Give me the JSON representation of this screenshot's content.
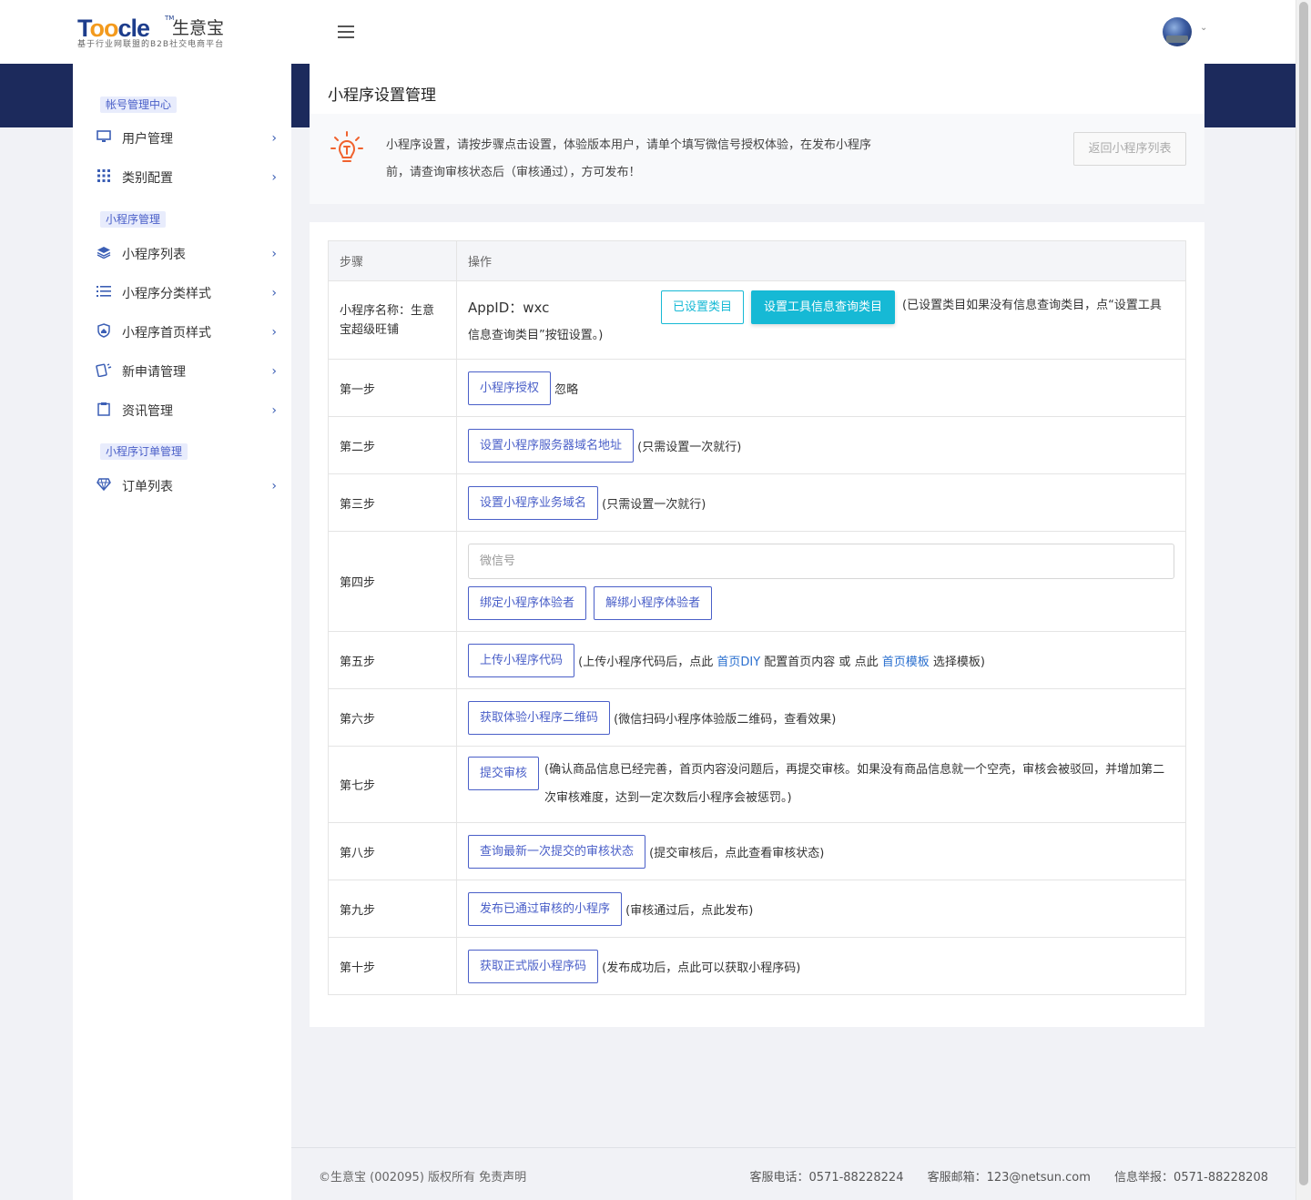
{
  "header": {
    "logo_brand_a": "T",
    "logo_brand_oo": "oo",
    "logo_brand_b": "cle",
    "logo_tm": "TM",
    "logo_cn": "生意宝",
    "logo_slogan": "基于行业网联盟的B2B社交电商平台"
  },
  "sidebar": {
    "sections": [
      {
        "title": "帐号管理中心",
        "items": [
          {
            "label": "用户管理",
            "icon": "monitor-icon"
          },
          {
            "label": "类别配置",
            "icon": "grid-icon"
          }
        ]
      },
      {
        "title": "小程序管理",
        "items": [
          {
            "label": "小程序列表",
            "icon": "layers-icon"
          },
          {
            "label": "小程序分类样式",
            "icon": "list-icon"
          },
          {
            "label": "小程序首页样式",
            "icon": "shield-home-icon"
          },
          {
            "label": "新申请管理",
            "icon": "cards-icon"
          },
          {
            "label": "资讯管理",
            "icon": "clipboard-icon"
          }
        ]
      },
      {
        "title": "小程序订单管理",
        "items": [
          {
            "label": "订单列表",
            "icon": "diamond-icon"
          }
        ]
      }
    ]
  },
  "page": {
    "title": "小程序设置管理",
    "tip_line1": "小程序设置，请按步骤点击设置，体验版本用户，请单个填写微信号授权体验，在发布小程序",
    "tip_line2": "前，请查询审核状态后（审核通过），方可发布！",
    "back_button": "返回小程序列表"
  },
  "table": {
    "headers": [
      "步骤",
      "操作"
    ],
    "info_row": {
      "name": "小程序名称：生意宝超级旺铺",
      "appid": "AppID：wxc",
      "btn_set_category": "已设置类目",
      "btn_set_tool_category": "设置工具信息查询类目",
      "note": "(已设置类目如果没有信息查询类目，点“设置工具信息查询类目”按钮设置。)"
    },
    "steps": [
      {
        "step": "第一步",
        "button": "小程序授权",
        "note": "忽略"
      },
      {
        "step": "第二步",
        "button": "设置小程序服务器域名地址",
        "note": "(只需设置一次就行)"
      },
      {
        "step": "第三步",
        "button": "设置小程序业务域名",
        "note": "(只需设置一次就行)"
      },
      {
        "step": "第四步",
        "input_placeholder": "微信号",
        "button_bind": "绑定小程序体验者",
        "button_unbind": "解绑小程序体验者"
      },
      {
        "step": "第五步",
        "button": "上传小程序代码",
        "note_a": "(上传小程序代码后，点此 ",
        "link_a": "首页DIY",
        "note_b": " 配置首页内容 或 点此 ",
        "link_b": "首页模板",
        "note_c": " 选择模板)"
      },
      {
        "step": "第六步",
        "button": "获取体验小程序二维码",
        "note": "(微信扫码小程序体验版二维码，查看效果)"
      },
      {
        "step": "第七步",
        "button": "提交审核",
        "note": "(确认商品信息已经完善，首页内容没问题后，再提交审核。如果没有商品信息就一个空壳，审核会被驳回，并增加第二次审核难度，达到一定次数后小程序会被惩罚。)"
      },
      {
        "step": "第八步",
        "button": "查询最新一次提交的审核状态",
        "note": "(提交审核后，点此查看审核状态)"
      },
      {
        "step": "第九步",
        "button": "发布已通过审核的小程序",
        "note": "(审核通过后，点此发布)"
      },
      {
        "step": "第十步",
        "button": "获取正式版小程序码",
        "note": "(发布成功后，点此可以获取小程序码)"
      }
    ]
  },
  "footer": {
    "copyright": "©生意宝 (002095)   版权所有 免责声明",
    "phone": "客服电话：0571-88228224",
    "email": "客服邮箱：123@netsun.com",
    "report": "信息举报：0571-88228208"
  },
  "colors": {
    "primary": "#4a5fc8",
    "teal": "#16b9d5",
    "navy_band": "#1c2a5c",
    "tip_icon": "#f0622e"
  }
}
